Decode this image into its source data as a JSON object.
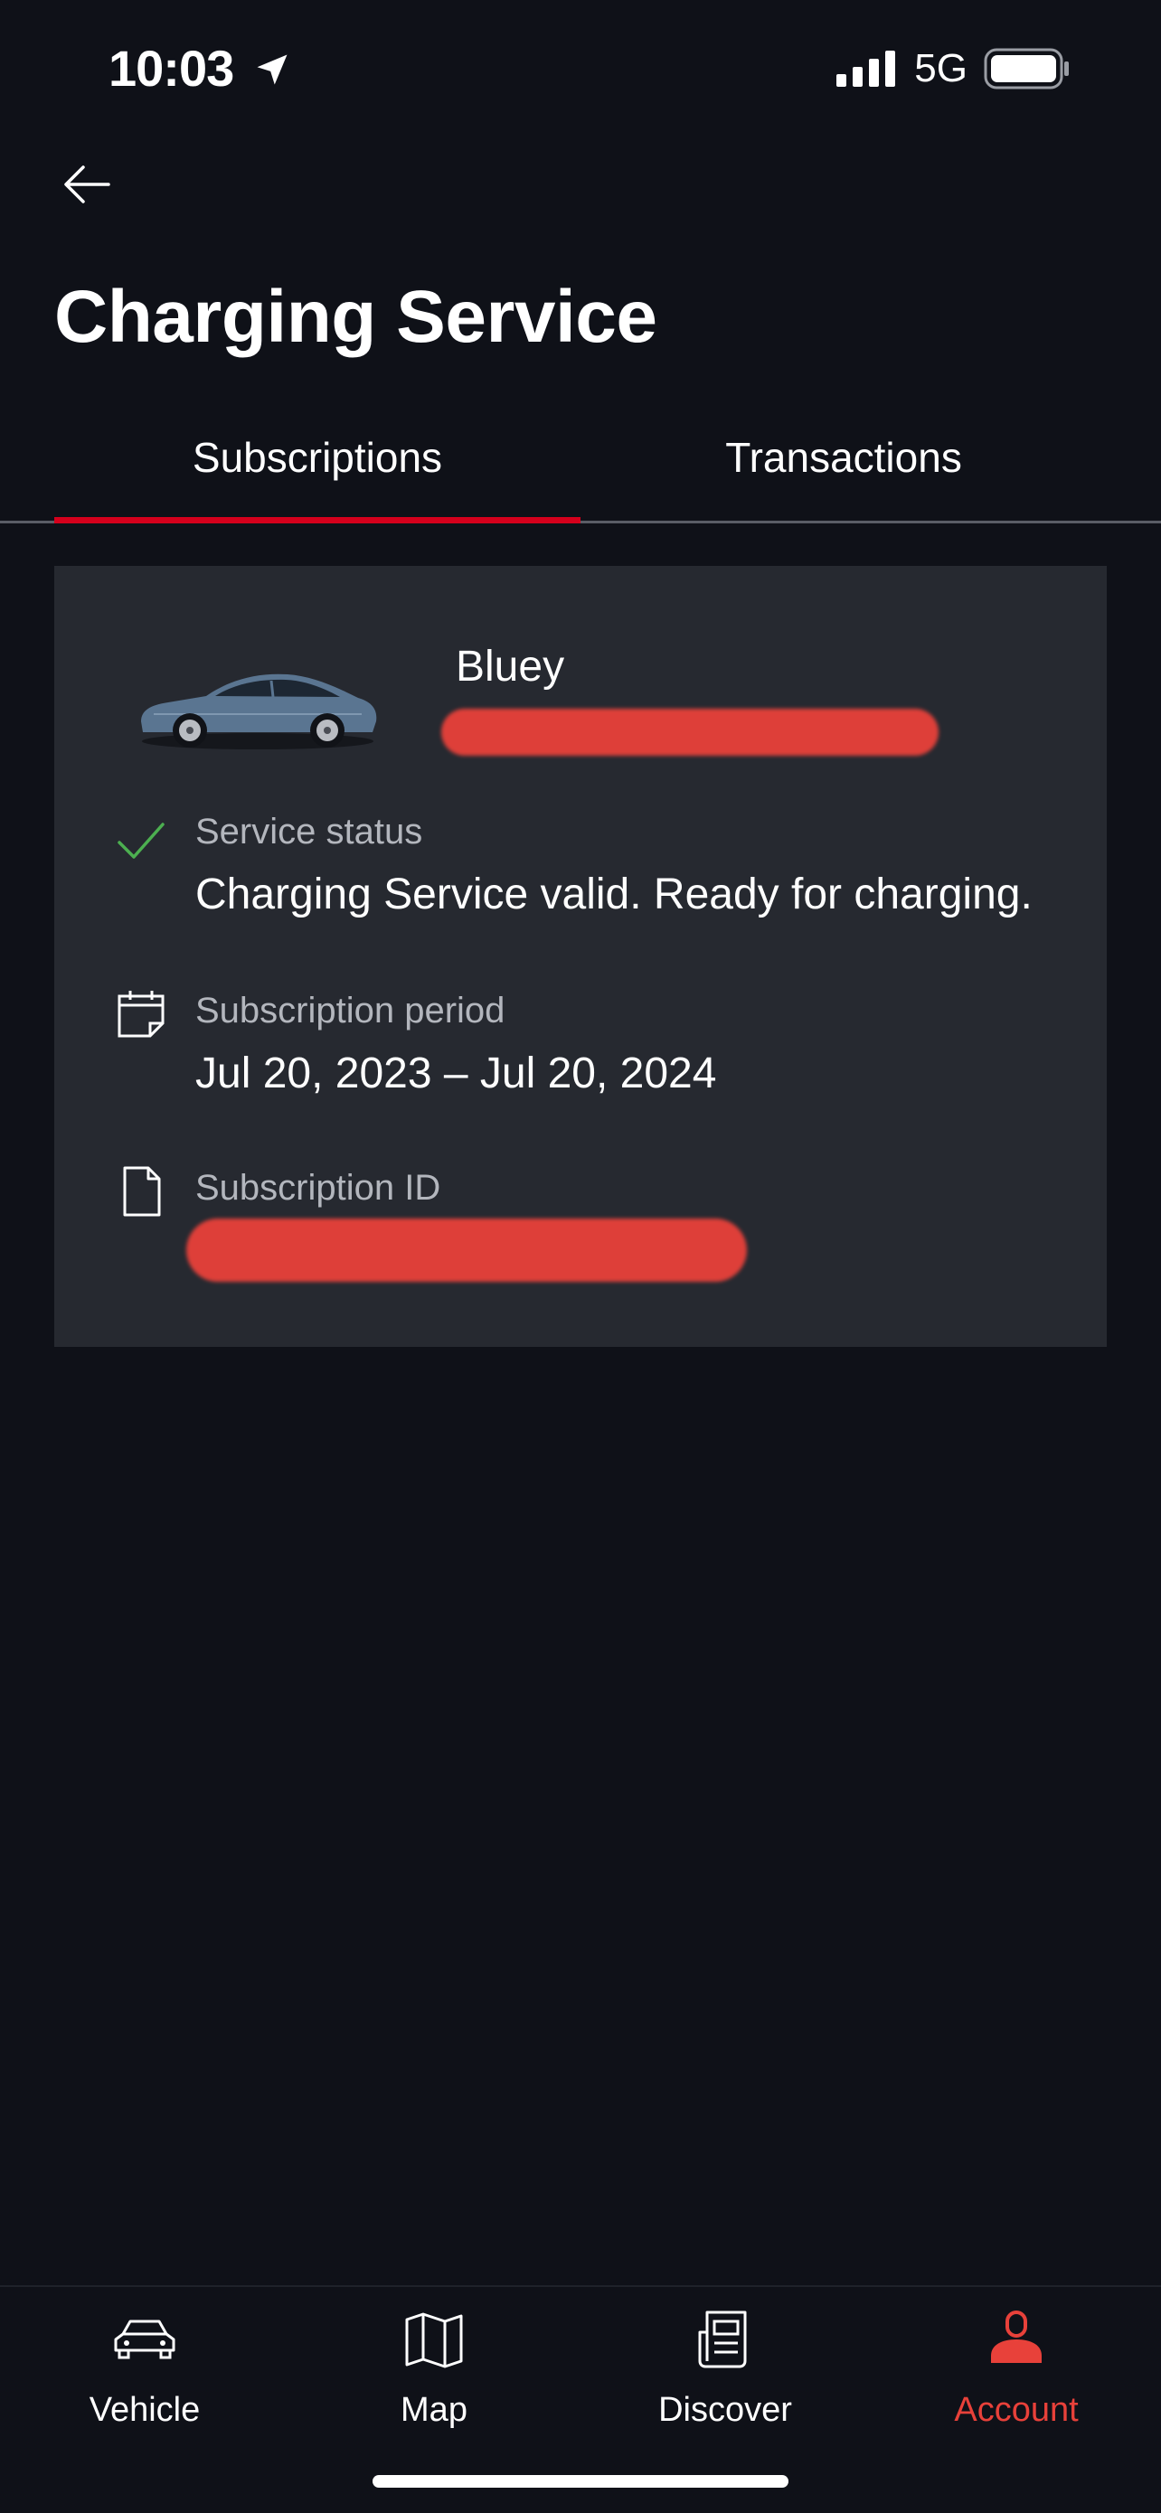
{
  "status_bar": {
    "time": "10:03",
    "network": "5G",
    "icons": [
      "location-arrow-icon",
      "signal-icon",
      "battery-icon"
    ]
  },
  "header": {
    "back_icon": "arrow-left-icon",
    "title": "Charging Service"
  },
  "tabs": [
    {
      "label": "Subscriptions",
      "active": true
    },
    {
      "label": "Transactions",
      "active": false
    }
  ],
  "card": {
    "vehicle_name": "Bluey",
    "vehicle_image": "car-image",
    "rows": [
      {
        "icon": "checkmark-icon",
        "label": "Service status",
        "value": "Charging Service valid. Ready for charging."
      },
      {
        "icon": "calendar-icon",
        "label": "Subscription period",
        "value": "Jul 20, 2023 – Jul 20, 2024"
      },
      {
        "icon": "document-icon",
        "label": "Subscription ID",
        "value": ""
      }
    ]
  },
  "bottom_nav": [
    {
      "label": "Vehicle",
      "icon": "car-icon",
      "active": false
    },
    {
      "label": "Map",
      "icon": "map-icon",
      "active": false
    },
    {
      "label": "Discover",
      "icon": "newspaper-icon",
      "active": false
    },
    {
      "label": "Account",
      "icon": "account-icon",
      "active": true
    }
  ],
  "colors": {
    "background": "#0f1118",
    "card": "#262930",
    "accent": "#d5001c",
    "active_nav": "#e8413a",
    "success": "#4caf50"
  }
}
